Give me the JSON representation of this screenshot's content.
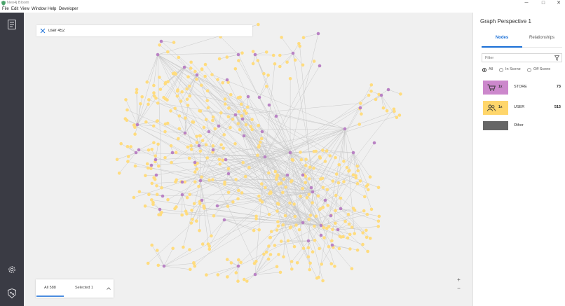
{
  "window": {
    "app_title": "Neo4j Bloom",
    "controls": [
      "─",
      "□",
      "✕"
    ]
  },
  "menu": [
    "File",
    "Edit",
    "View",
    "Window",
    "Help",
    "Developer"
  ],
  "sidebar": {
    "top_icon": "perspective-icon",
    "bottom_icons": [
      "settings-icon",
      "neo4j-logo-icon"
    ]
  },
  "search": {
    "value": "user 452",
    "clear_icon": "close-icon"
  },
  "stats": {
    "all_label": "All 588",
    "selected_label": "Selected 1",
    "expand_icon": "chevron-up-icon"
  },
  "zoom": {
    "in_label": "+",
    "out_label": "−"
  },
  "panel": {
    "title": "Graph Perspective 1",
    "tabs": [
      "Nodes",
      "Relationships"
    ],
    "active_tab": "Nodes",
    "filter_placeholder": "Filter",
    "scope_options": [
      "All",
      "In Scene",
      "Off Scene"
    ],
    "scope_selected": "All",
    "categories": [
      {
        "name": "STORE",
        "size": "1x",
        "count": "73",
        "color": "#cc88cc",
        "icon": "shopping-cart-icon"
      },
      {
        "name": "USER",
        "size": "1x",
        "count": "515",
        "color": "#ffd66b",
        "icon": "users-icon"
      },
      {
        "name": "Other",
        "size": "",
        "count": "",
        "color": "#666666",
        "icon": ""
      }
    ]
  },
  "colors": {
    "rail": "#3a3b44",
    "canvas": "#f0f0f0",
    "store_node": "#b982c4",
    "user_node": "#ffdc7e",
    "edge": "#c9c9c9",
    "accent": "#1a6fd6"
  }
}
